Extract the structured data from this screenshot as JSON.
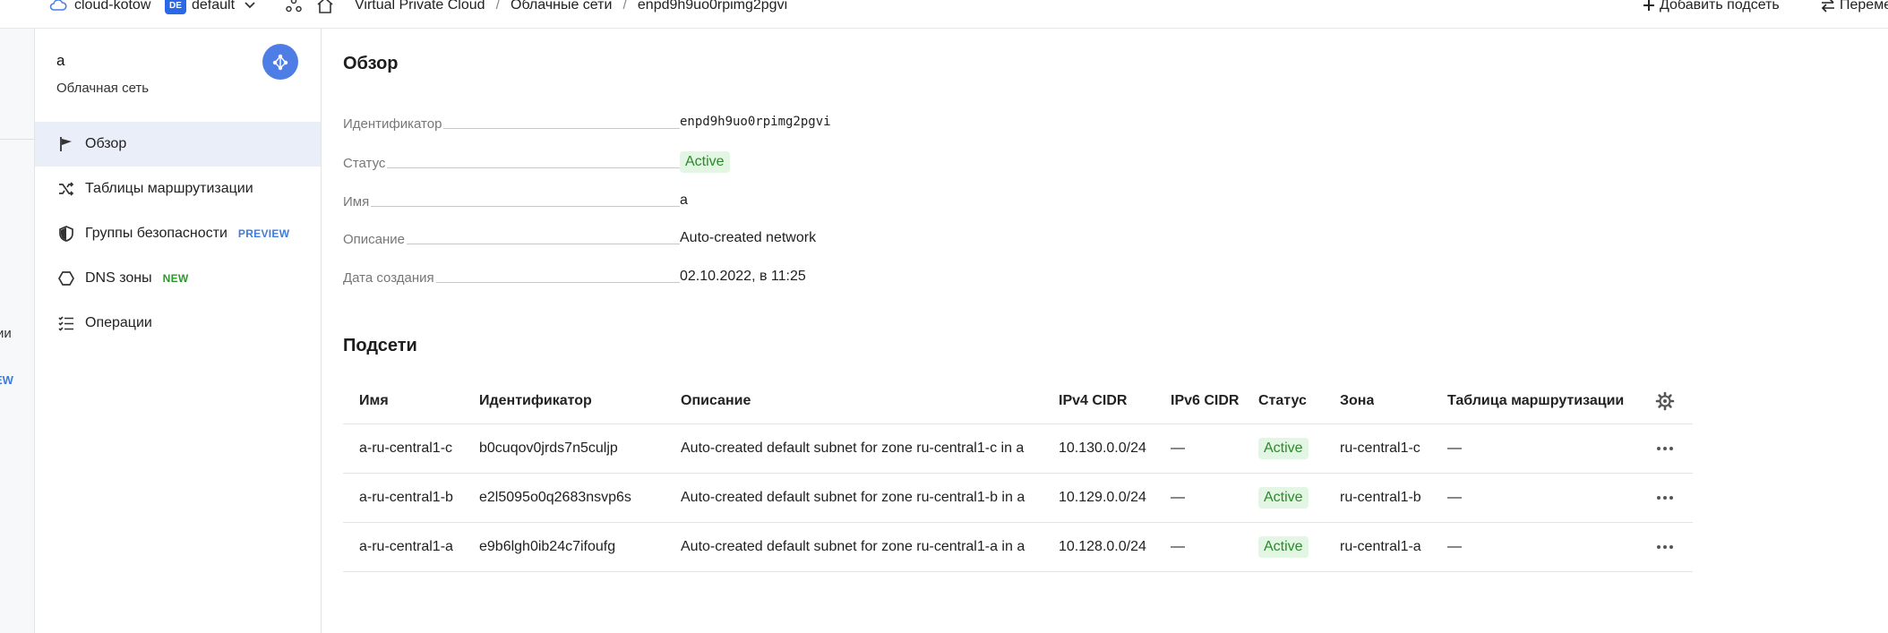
{
  "topbar": {
    "cloud_name": "cloud-kotow",
    "folder_badge": "DE",
    "folder_name": "default",
    "breadcrumbs": [
      "Virtual Private Cloud",
      "Облачные сети",
      "enpd9h9uo0rpimg2pgvi"
    ],
    "add_subnet_label": "Добавить подсеть",
    "move_label": "Переме"
  },
  "strip": {
    "text_1": "ии",
    "text_2": "EW"
  },
  "sidebar": {
    "title": "a",
    "subtitle": "Облачная сеть",
    "items": [
      {
        "label": "Обзор",
        "icon": "flag-icon",
        "active": true
      },
      {
        "label": "Таблицы маршрутизации",
        "icon": "shuffle-icon"
      },
      {
        "label": "Группы безопасности",
        "icon": "shield-icon",
        "tag": "PREVIEW"
      },
      {
        "label": "DNS зоны",
        "icon": "hexagon-icon",
        "tag": "NEW"
      },
      {
        "label": "Операции",
        "icon": "checklist-icon"
      }
    ]
  },
  "overview": {
    "heading": "Обзор",
    "properties": [
      {
        "label": "Идентификатор",
        "value": "enpd9h9uo0rpimg2pgvi"
      },
      {
        "label": "Статус",
        "value": "Active"
      },
      {
        "label": "Имя",
        "value": "a"
      },
      {
        "label": "Описание",
        "value": "Auto-created network"
      },
      {
        "label": "Дата создания",
        "value": "02.10.2022, в 11:25"
      }
    ]
  },
  "subnets": {
    "heading": "Подсети",
    "columns": [
      "Имя",
      "Идентификатор",
      "Описание",
      "IPv4 CIDR",
      "IPv6 CIDR",
      "Статус",
      "Зона",
      "Таблица маршрутизации"
    ],
    "rows": [
      {
        "name": "a-ru-central1-c",
        "id": "b0cuqov0jrds7n5culjp",
        "description": "Auto-created default subnet for zone ru-central1-c in a",
        "ipv4": "10.130.0.0/24",
        "ipv6": "—",
        "status": "Active",
        "zone": "ru-central1-c",
        "route_table": "—"
      },
      {
        "name": "a-ru-central1-b",
        "id": "e2l5095o0q2683nsvp6s",
        "description": "Auto-created default subnet for zone ru-central1-b in a",
        "ipv4": "10.129.0.0/24",
        "ipv6": "—",
        "status": "Active",
        "zone": "ru-central1-b",
        "route_table": "—"
      },
      {
        "name": "a-ru-central1-a",
        "id": "e9b6lgh0ib24c7ifoufg",
        "description": "Auto-created default subnet for zone ru-central1-a in a",
        "ipv4": "10.128.0.0/24",
        "ipv6": "—",
        "status": "Active",
        "zone": "ru-central1-a",
        "route_table": "—"
      }
    ]
  }
}
